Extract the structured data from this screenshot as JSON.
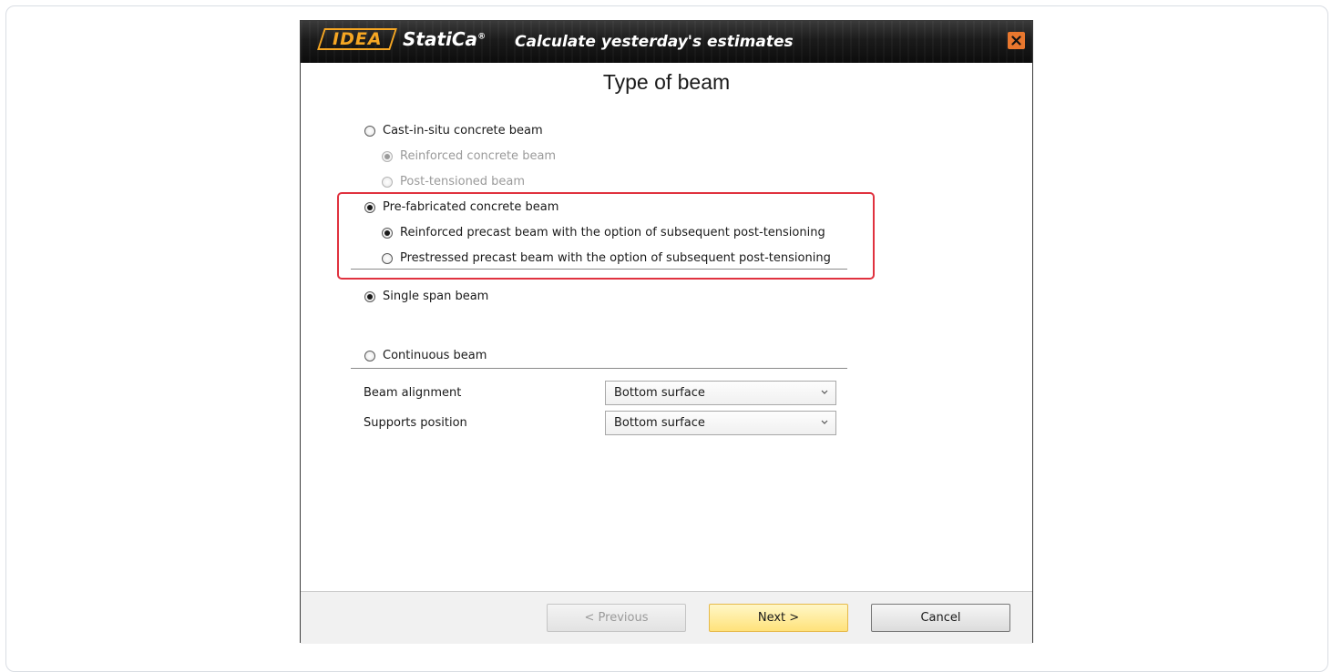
{
  "header": {
    "logo_idea": "IDEA",
    "logo_statica": "StatiCa",
    "logo_reg": "®",
    "tagline": "Calculate yesterday's estimates",
    "close_icon": "close-icon"
  },
  "page": {
    "title": "Type of beam"
  },
  "options": {
    "cast_in_situ": {
      "label": "Cast-in-situ concrete beam",
      "checked": false
    },
    "reinforced_concrete": {
      "label": "Reinforced concrete beam",
      "checked": true,
      "disabled": true
    },
    "post_tensioned": {
      "label": "Post-tensioned beam",
      "checked": false,
      "disabled": true
    },
    "pre_fabricated": {
      "label": "Pre-fabricated concrete beam",
      "checked": true
    },
    "reinforced_precast": {
      "label": "Reinforced precast beam with the option of subsequent post-tensioning",
      "checked": true
    },
    "prestressed_precast": {
      "label": "Prestressed precast beam with the option of subsequent post-tensioning",
      "checked": false
    },
    "single_span": {
      "label": "Single span beam",
      "checked": true
    },
    "continuous": {
      "label": "Continuous beam",
      "checked": false
    }
  },
  "fields": {
    "beam_alignment": {
      "label": "Beam alignment",
      "value": "Bottom surface"
    },
    "supports_position": {
      "label": "Supports position",
      "value": "Bottom surface"
    }
  },
  "footer": {
    "previous_label": "< Previous",
    "next_label": "Next >",
    "cancel_label": "Cancel"
  },
  "colors": {
    "highlight": "#e0323f",
    "logo_orange": "#f5a623",
    "next_button": "#ffe27a",
    "close_button": "#e8772e"
  }
}
